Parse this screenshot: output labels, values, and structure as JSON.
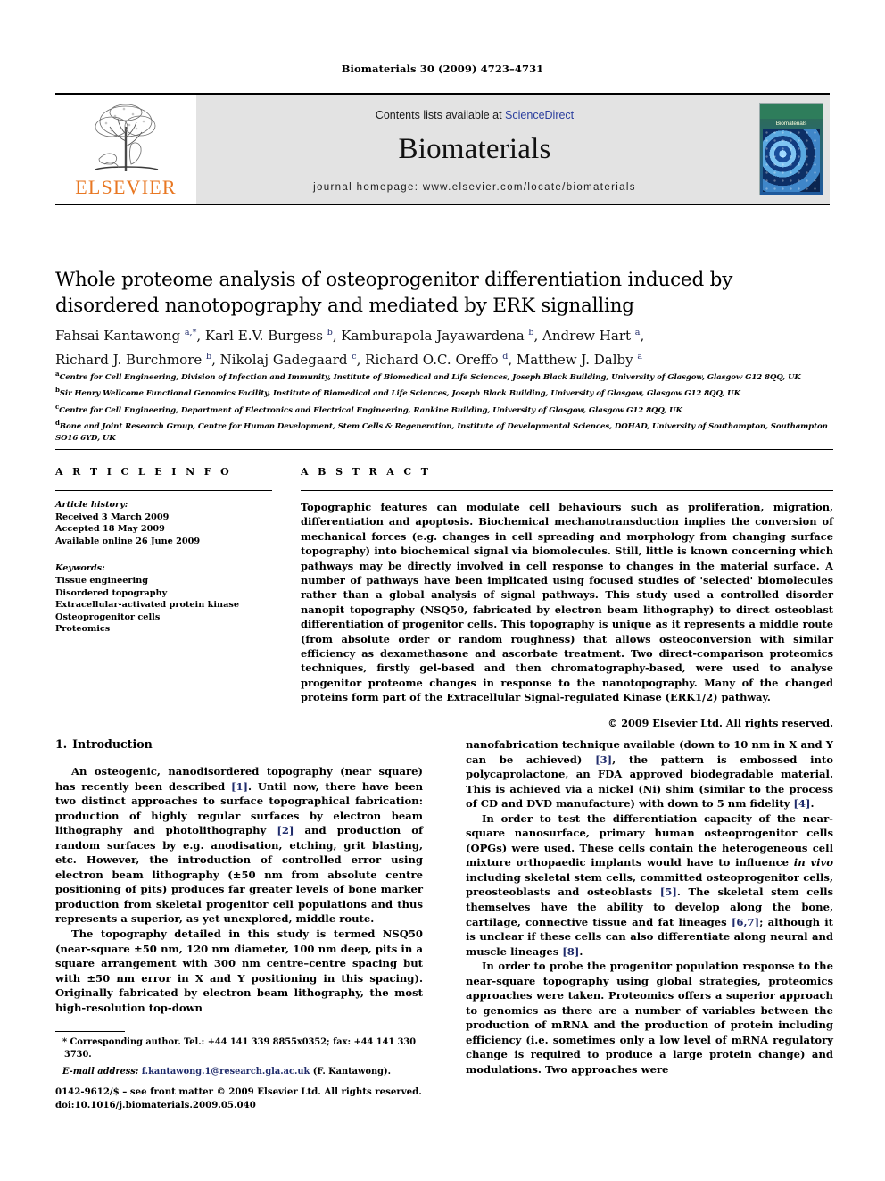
{
  "running_head": "Biomaterials 30 (2009) 4723–4731",
  "masthead": {
    "publisher_name": "ELSEVIER",
    "contents_prefix": "Contents lists available at ",
    "contents_link": "ScienceDirect",
    "journal_name": "Biomaterials",
    "homepage": "journal homepage: www.elsevier.com/locate/biomaterials",
    "cover_title": "Biomaterials",
    "accent_orange": "#E87722",
    "link_blue": "#2b3f9e",
    "band_grey": "#e3e3e3"
  },
  "article": {
    "title": "Whole proteome analysis of osteoprogenitor differentiation induced by disordered nanotopography and mediated by ERK signalling",
    "authors_line1_html": "Fahsai Kantawong <sup>a,*</sup>, Karl E.V. Burgess <sup>b</sup>, Kamburapola Jayawardena <sup>b</sup>, Andrew Hart <sup>a</sup>,",
    "authors_line2_html": "Richard J. Burchmore <sup>b</sup>, Nikolaj Gadegaard <sup>c</sup>, Richard O.C. Oreffo <sup>d</sup>, Matthew J. Dalby <sup>a</sup>",
    "affiliations": [
      {
        "marker": "a",
        "text": "Centre for Cell Engineering, Division of Infection and Immunity, Institute of Biomedical and Life Sciences, Joseph Black Building, University of Glasgow, Glasgow G12 8QQ, UK"
      },
      {
        "marker": "b",
        "text": "Sir Henry Wellcome Functional Genomics Facility, Institute of Biomedical and Life Sciences, Joseph Black Building, University of Glasgow, Glasgow G12 8QQ, UK"
      },
      {
        "marker": "c",
        "text": "Centre for Cell Engineering, Department of Electronics and Electrical Engineering, Rankine Building, University of Glasgow, Glasgow G12 8QQ, UK"
      },
      {
        "marker": "d",
        "text": "Bone and Joint Research Group, Centre for Human Development, Stem Cells & Regeneration, Institute of Developmental Sciences, DOHAD, University of Southampton, Southampton SO16 6YD, UK"
      }
    ]
  },
  "article_info": {
    "heading": "A R T I C L E  I N F O",
    "history_label": "Article history:",
    "history": [
      "Received 3 March 2009",
      "Accepted 18 May 2009",
      "Available online 26 June 2009"
    ],
    "keywords_label": "Keywords:",
    "keywords": [
      "Tissue engineering",
      "Disordered topography",
      "Extracellular-activated protein kinase",
      "Osteoprogenitor cells",
      "Proteomics"
    ]
  },
  "abstract": {
    "heading": "A B S T R A C T",
    "text": "Topographic features can modulate cell behaviours such as proliferation, migration, differentiation and apoptosis. Biochemical mechanotransduction implies the conversion of mechanical forces (e.g. changes in cell spreading and morphology from changing surface topography) into biochemical signal via biomolecules. Still, little is known concerning which pathways may be directly involved in cell response to changes in the material surface. A number of pathways have been implicated using focused studies of 'selected' biomolecules rather than a global analysis of signal pathways. This study used a controlled disorder nanopit topography (NSQ50, fabricated by electron beam lithography) to direct osteoblast differentiation of progenitor cells. This topography is unique as it represents a middle route (from absolute order or random roughness) that allows osteoconversion with similar efficiency as dexamethasone and ascorbate treatment. Two direct-comparison proteomics techniques, firstly gel-based and then chromatography-based, were used to analyse progenitor proteome changes in response to the nanotopography. Many of the changed proteins form part of the Extracellular Signal-regulated Kinase (ERK1/2) pathway.",
    "copyright": "© 2009 Elsevier Ltd. All rights reserved."
  },
  "body": {
    "section_number": "1.",
    "section_title": "Introduction",
    "left_paragraphs": [
      "An osteogenic, nanodisordered topography (near square) has recently been described [1]. Until now, there have been two distinct approaches to surface topographical fabrication: production of highly regular surfaces by electron beam lithography and photolithography [2] and production of random surfaces by e.g. anodisation, etching, grit blasting, etc. However, the introduction of controlled error using electron beam lithography (±50 nm from absolute centre positioning of pits) produces far greater levels of bone marker production from skeletal progenitor cell populations and thus represents a superior, as yet unexplored, middle route.",
      "The topography detailed in this study is termed NSQ50 (near-square ±50 nm, 120 nm diameter, 100 nm deep, pits in a square arrangement with 300 nm centre–centre spacing but with ±50 nm error in X and Y positioning in this spacing). Originally fabricated by electron beam lithography, the most high-resolution top-down"
    ],
    "right_paragraphs": [
      "nanofabrication technique available (down to 10 nm in X and Y can be achieved) [3], the pattern is embossed into polycaprolactone, an FDA approved biodegradable material. This is achieved via a nickel (Ni) shim (similar to the process of CD and DVD manufacture) with down to 5 nm fidelity [4].",
      "In order to test the differentiation capacity of the near-square nanosurface, primary human osteoprogenitor cells (OPGs) were used. These cells contain the heterogeneous cell mixture orthopaedic implants would have to influence in vivo including skeletal stem cells, committed osteoprogenitor cells, preosteoblasts and osteoblasts [5]. The skeletal stem cells themselves have the ability to develop along the bone, cartilage, connective tissue and fat lineages [6,7]; although it is unclear if these cells can also differentiate along neural and muscle lineages [8].",
      "In order to probe the progenitor population response to the near-square topography using global strategies, proteomics approaches were taken. Proteomics offers a superior approach to genomics as there are a number of variables between the production of mRNA and the production of protein including efficiency (i.e. sometimes only a low level of mRNA regulatory change is required to produce a large protein change) and modulations. Two approaches were"
    ]
  },
  "footnote": {
    "corresponding": "* Corresponding author. Tel.: +44 141 339 8855x0352; fax: +44 141 330 3730.",
    "email_label": "E-mail address:",
    "email": "f.kantawong.1@research.gla.ac.uk",
    "email_suffix": "(F. Kantawong)."
  },
  "imprint": {
    "line1": "0142-9612/$ – see front matter © 2009 Elsevier Ltd. All rights reserved.",
    "line2": "doi:10.1016/j.biomaterials.2009.05.040"
  }
}
